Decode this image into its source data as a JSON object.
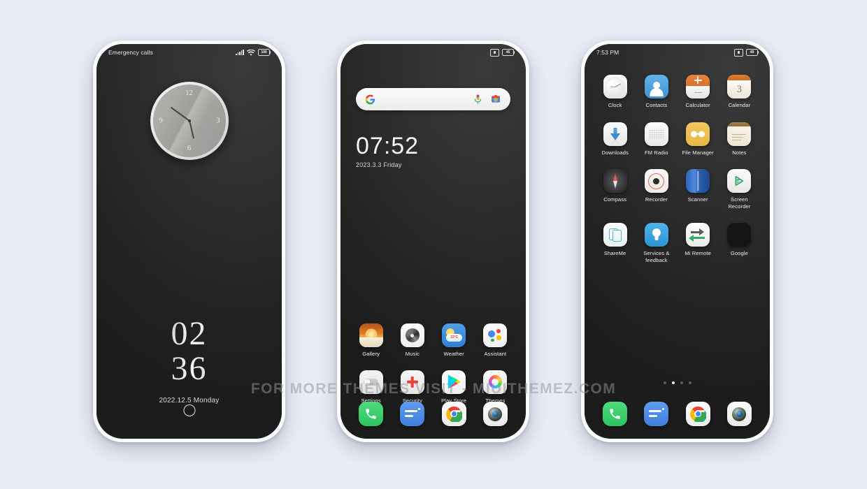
{
  "watermark": "FOR MORE THEMES VISIT - MIUITHEMEZ.COM",
  "background_color": "#e9ecf5",
  "phones": {
    "lockscreen": {
      "statusbar": {
        "left_text": "Emergency calls",
        "signal_icon": "signal-bars-icon",
        "wifi_icon": "wifi-icon",
        "battery_level": "100"
      },
      "clock_widget": {
        "name": "analog-clock-widget",
        "numerals": [
          "12",
          "3",
          "6",
          "9"
        ]
      },
      "time_hours": "02",
      "time_minutes": "36",
      "date": "2022.12.5 Monday",
      "unlock": "unlock-ring"
    },
    "homescreen": {
      "statusbar": {
        "left_text": "",
        "cast_icon": "cast-icon",
        "battery_level": "45"
      },
      "search": {
        "placeholder": "",
        "google_icon": "google-g-icon",
        "mic_icon": "microphone-icon",
        "lens_icon": "google-lens-icon"
      },
      "time": "07:52",
      "date": "2023.3.3 Friday",
      "apps": [
        {
          "label": "Gallery",
          "icon": "gallery-icon"
        },
        {
          "label": "Music",
          "icon": "music-icon"
        },
        {
          "label": "Weather",
          "icon": "weather-icon"
        },
        {
          "label": "Assistant",
          "icon": "assistant-icon"
        },
        {
          "label": "Settings",
          "icon": "settings-icon"
        },
        {
          "label": "Security",
          "icon": "security-icon"
        },
        {
          "label": "Play Store",
          "icon": "play-store-icon"
        },
        {
          "label": "Themes",
          "icon": "themes-icon"
        }
      ],
      "dock": [
        {
          "label": "Phone",
          "icon": "phone-icon"
        },
        {
          "label": "Messages",
          "icon": "messages-icon"
        },
        {
          "label": "Chrome",
          "icon": "chrome-icon"
        },
        {
          "label": "Camera",
          "icon": "camera-icon"
        }
      ]
    },
    "appdrawer": {
      "statusbar": {
        "left_text": "7:53 PM",
        "cast_icon": "cast-icon",
        "battery_level": "49"
      },
      "apps": [
        {
          "label": "Clock",
          "icon": "clock-icon"
        },
        {
          "label": "Contacts",
          "icon": "contacts-icon"
        },
        {
          "label": "Calculator",
          "icon": "calculator-icon"
        },
        {
          "label": "Calendar",
          "icon": "calendar-icon"
        },
        {
          "label": "Downloads",
          "icon": "downloads-icon"
        },
        {
          "label": "FM Radio",
          "icon": "fm-radio-icon"
        },
        {
          "label": "File Manager",
          "icon": "file-manager-icon"
        },
        {
          "label": "Notes",
          "icon": "notes-icon"
        },
        {
          "label": "Compass",
          "icon": "compass-icon"
        },
        {
          "label": "Recorder",
          "icon": "recorder-icon"
        },
        {
          "label": "Scanner",
          "icon": "scanner-icon"
        },
        {
          "label": "Screen Recorder",
          "icon": "screen-recorder-icon"
        },
        {
          "label": "ShareMe",
          "icon": "shareme-icon"
        },
        {
          "label": "Services & feedback",
          "icon": "services-feedback-icon"
        },
        {
          "label": "Mi Remote",
          "icon": "mi-remote-icon"
        },
        {
          "label": "Google",
          "icon": "google-folder-icon"
        }
      ],
      "calendar_day": "3",
      "page_dots": 4,
      "active_dot": 2,
      "dock": [
        {
          "label": "Phone",
          "icon": "phone-icon"
        },
        {
          "label": "Messages",
          "icon": "messages-icon"
        },
        {
          "label": "Chrome",
          "icon": "chrome-icon"
        },
        {
          "label": "Camera",
          "icon": "camera-icon"
        }
      ]
    }
  }
}
